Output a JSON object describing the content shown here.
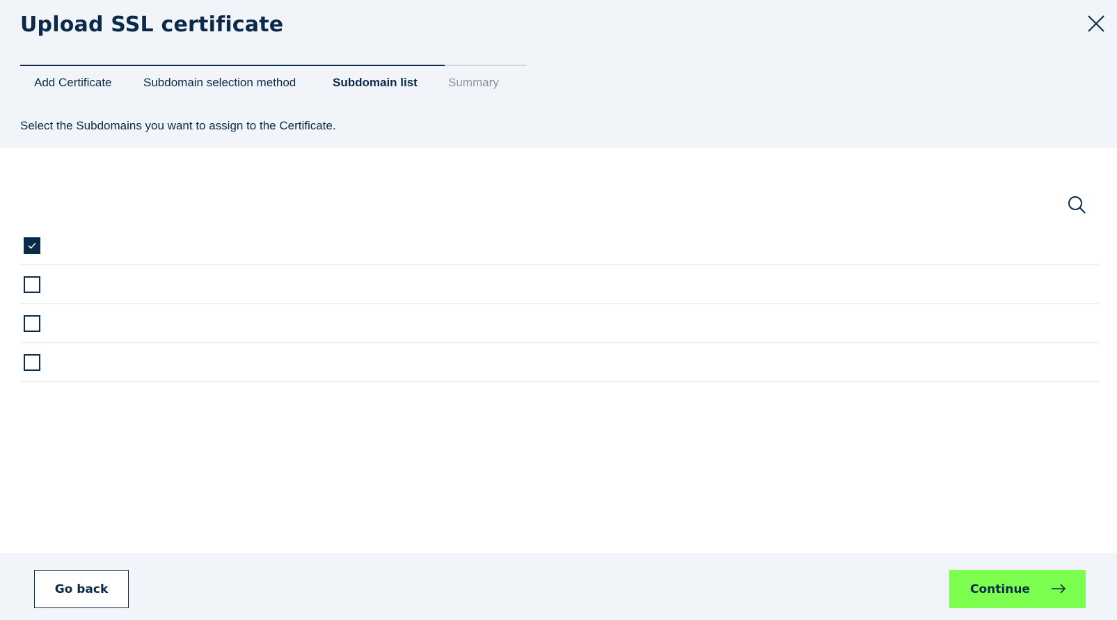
{
  "dialog": {
    "title": "Upload SSL certificate"
  },
  "steps": [
    {
      "label": "Add Certificate",
      "state": "done"
    },
    {
      "label": "Subdomain selection method",
      "state": "done"
    },
    {
      "label": "Subdomain list",
      "state": "active"
    },
    {
      "label": "Summary",
      "state": "upcoming"
    }
  ],
  "instructions": "Select the Subdomains you want to assign to the Certificate.",
  "subdomains": [
    {
      "label": "",
      "checked": true
    },
    {
      "label": "",
      "checked": false
    },
    {
      "label": "",
      "checked": false
    },
    {
      "label": "",
      "checked": false
    }
  ],
  "footer": {
    "back_label": "Go back",
    "continue_label": "Continue"
  },
  "icons": {
    "close": "close-icon",
    "search": "search-icon",
    "check": "check-icon",
    "arrow": "arrow-right-icon"
  },
  "colors": {
    "primary": "#0b2a4a",
    "accent": "#7dff4f",
    "muted": "#8a969f",
    "background": "#f1f5f9"
  }
}
